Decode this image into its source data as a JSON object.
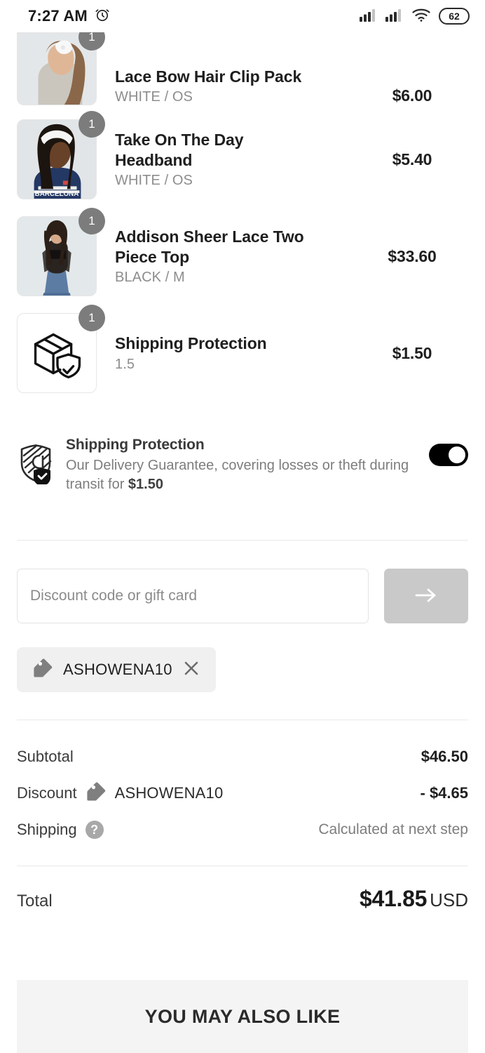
{
  "status_bar": {
    "time": "7:27 AM",
    "alarm_icon": "alarm-clock-icon",
    "signal_1_icon": "signal-bars-icon",
    "signal_2_icon": "signal-bars-icon",
    "wifi_icon": "wifi-icon",
    "battery_level": "62"
  },
  "cart": {
    "items": [
      {
        "title": "Lace Bow Hair Clip Pack",
        "variant": "WHITE / OS",
        "price": "$6.00",
        "qty": "1",
        "thumb": "model-hair-clip-photo"
      },
      {
        "title": "Take On The Day Headband",
        "variant": "WHITE / OS",
        "price": "$5.40",
        "qty": "1",
        "thumb": "model-headband-photo"
      },
      {
        "title": "Addison Sheer Lace Two Piece Top",
        "variant": "BLACK / M",
        "price": "$33.60",
        "qty": "1",
        "thumb": "model-lace-top-photo"
      },
      {
        "title": "Shipping Protection",
        "variant": "1.5",
        "price": "$1.50",
        "qty": "1",
        "thumb": "package-shield-icon"
      }
    ]
  },
  "shipping_protection": {
    "logo_icon": "shield-protection-logo",
    "title": "Shipping Protection",
    "description_prefix": "Our Delivery Guarantee, covering losses or theft during transit for ",
    "description_amount": "$1.50",
    "toggle_state": "on"
  },
  "discount": {
    "placeholder": "Discount code or gift card",
    "value": "",
    "apply_icon": "arrow-right-icon",
    "applied_code": "ASHOWENA10",
    "tag_icon": "discount-tag-icon",
    "remove_icon": "close-icon"
  },
  "summary": {
    "rows": [
      {
        "label": "Subtotal",
        "code": "",
        "value": "$46.50",
        "muted": false
      },
      {
        "label": "Discount",
        "code": "ASHOWENA10",
        "value": "- $4.65",
        "muted": false
      },
      {
        "label": "Shipping",
        "code": "",
        "value": "Calculated at next step",
        "muted": true
      }
    ],
    "shipping_help_icon": "help-circle-icon",
    "total_label": "Total",
    "total_amount": "$41.85",
    "total_currency": "USD"
  },
  "recommendations": {
    "heading": "YOU MAY ALSO LIKE"
  },
  "colors": {
    "accent_black": "#000000",
    "badge_gray": "#7c7c7c",
    "chip_bg": "#f0f0f0",
    "apply_btn_bg": "#c9c9c9",
    "panel_bg": "#f4f4f4"
  }
}
